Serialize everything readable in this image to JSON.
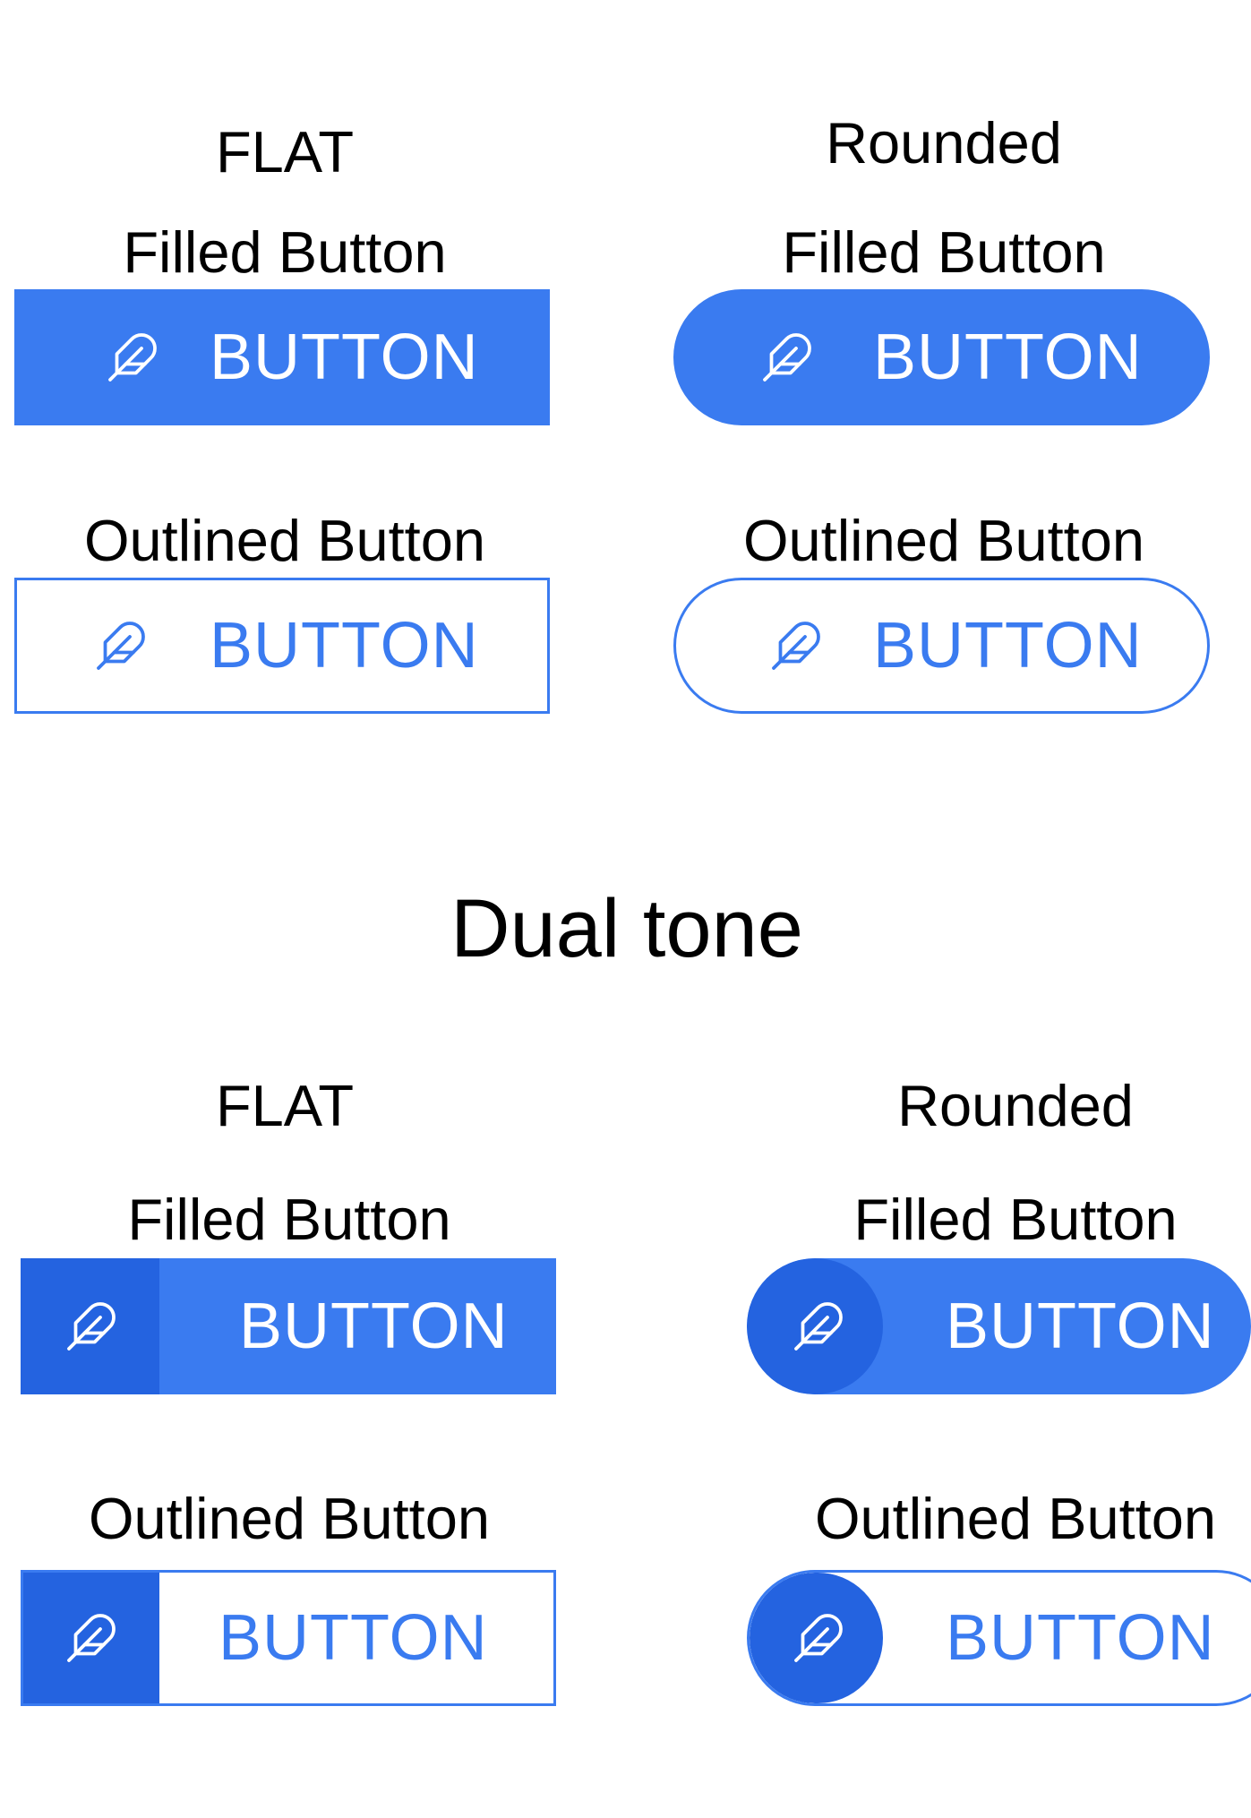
{
  "colors": {
    "accent": "#3a7bf0",
    "accent_dark": "#2463e0",
    "background": "#ffffff"
  },
  "top": {
    "flat": {
      "title": "FLAT",
      "filled_label": "Filled Button",
      "filled_button": "BUTTON",
      "outlined_label": "Outlined Button",
      "outlined_button": "BUTTON"
    },
    "rounded": {
      "title": "Rounded",
      "filled_label": "Filled Button",
      "filled_button": "BUTTON",
      "outlined_label": "Outlined Button",
      "outlined_button": "BUTTON"
    }
  },
  "dual_tone": {
    "heading": "Dual tone",
    "flat": {
      "title": "FLAT",
      "filled_label": "Filled Button",
      "filled_button": "BUTTON",
      "outlined_label": "Outlined Button",
      "outlined_button": "BUTTON"
    },
    "rounded": {
      "title": "Rounded",
      "filled_label": "Filled Button",
      "filled_button": "BUTTON",
      "outlined_label": "Outlined Button",
      "outlined_button": "BUTTON"
    }
  },
  "icon": "feather-icon"
}
